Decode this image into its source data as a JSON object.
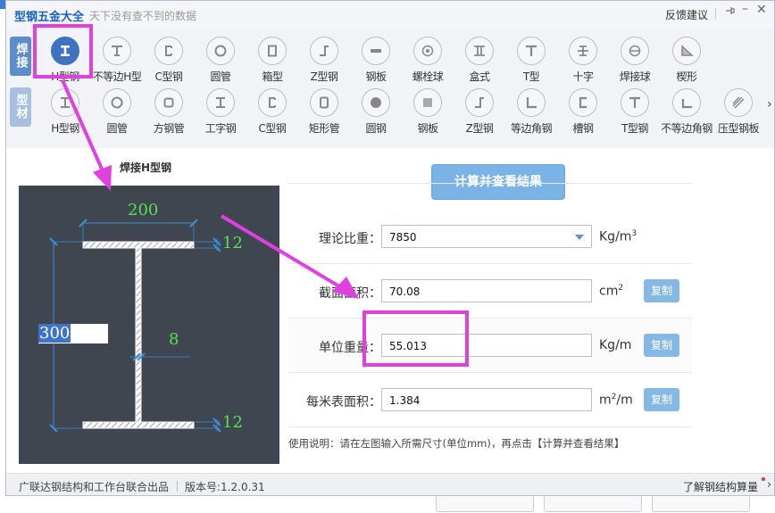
{
  "app": {
    "title": "型钢五金大全",
    "subtitle": "天下没有查不到的数据",
    "feedback": "反馈建议"
  },
  "categories": [
    {
      "label": "焊接",
      "active": true
    },
    {
      "label": "型材",
      "active": false
    }
  ],
  "row1": [
    {
      "label": "H型钢",
      "icon": "h-beam-icon",
      "selected": true
    },
    {
      "label": "不等边H型",
      "icon": "unequal-h-icon"
    },
    {
      "label": "C型钢",
      "icon": "c-channel-icon"
    },
    {
      "label": "圆管",
      "icon": "round-tube-icon"
    },
    {
      "label": "箱型",
      "icon": "box-section-icon"
    },
    {
      "label": "Z型钢",
      "icon": "z-section-icon"
    },
    {
      "label": "钢板",
      "icon": "steel-plate-icon"
    },
    {
      "label": "螺栓球",
      "icon": "bolt-ball-icon"
    },
    {
      "label": "盒式",
      "icon": "box-type-icon"
    },
    {
      "label": "T型",
      "icon": "t-section-icon"
    },
    {
      "label": "十字",
      "icon": "cross-section-icon"
    },
    {
      "label": "焊接球",
      "icon": "welded-ball-icon"
    },
    {
      "label": "楔形",
      "icon": "wedge-icon"
    }
  ],
  "row2": [
    {
      "label": "H型钢",
      "icon": "h-beam-icon"
    },
    {
      "label": "圆管",
      "icon": "round-tube-icon"
    },
    {
      "label": "方钢管",
      "icon": "square-tube-icon"
    },
    {
      "label": "工字钢",
      "icon": "i-beam-icon"
    },
    {
      "label": "C型钢",
      "icon": "c-channel-icon"
    },
    {
      "label": "矩形管",
      "icon": "rect-tube-icon"
    },
    {
      "label": "圆钢",
      "icon": "round-bar-icon"
    },
    {
      "label": "钢板",
      "icon": "steel-plate-icon"
    },
    {
      "label": "Z型钢",
      "icon": "z-section-icon"
    },
    {
      "label": "等边角钢",
      "icon": "equal-angle-icon"
    },
    {
      "label": "槽钢",
      "icon": "channel-icon"
    },
    {
      "label": "T型钢",
      "icon": "t-section-icon"
    },
    {
      "label": "不等边角钢",
      "icon": "unequal-angle-icon"
    },
    {
      "label": "压型钢板",
      "icon": "profiled-sheet-icon"
    }
  ],
  "diagram": {
    "title": "焊接H型钢",
    "width": "200",
    "top_flange": "12",
    "web": "8",
    "bottom_flange": "12",
    "height": "300"
  },
  "calc_button": "计算并查看结果",
  "results": [
    {
      "label": "理论比重",
      "value": "7850",
      "unit_base": "Kg/m",
      "unit_sup": "3",
      "dropdown": true
    },
    {
      "label": "截面面积",
      "value": "70.08",
      "unit_base": "cm",
      "unit_sup": "2",
      "copy": "复制"
    },
    {
      "label": "单位重量",
      "value": "55.013",
      "unit_base": "Kg/m",
      "unit_sup": "",
      "copy": "复制"
    },
    {
      "label": "每米表面积",
      "value": "1.384",
      "unit_base": "m",
      "unit_sup": "2",
      "unit_tail": "/m",
      "copy": "复制"
    }
  ],
  "colon": "：",
  "usage": "使用说明：请在左图输入所需尺寸(单位mm)，再点击【计算并查看结果】",
  "footer": {
    "left": "广联达钢结构和工作台联合出品",
    "version": "版本号:1.2.0.31",
    "right": "了解钢结构算量"
  },
  "colors": {
    "accent": "#3f73c2",
    "annotation": "#e040e0",
    "button": "#7ab3e6",
    "dim_green": "#4ee04e"
  }
}
